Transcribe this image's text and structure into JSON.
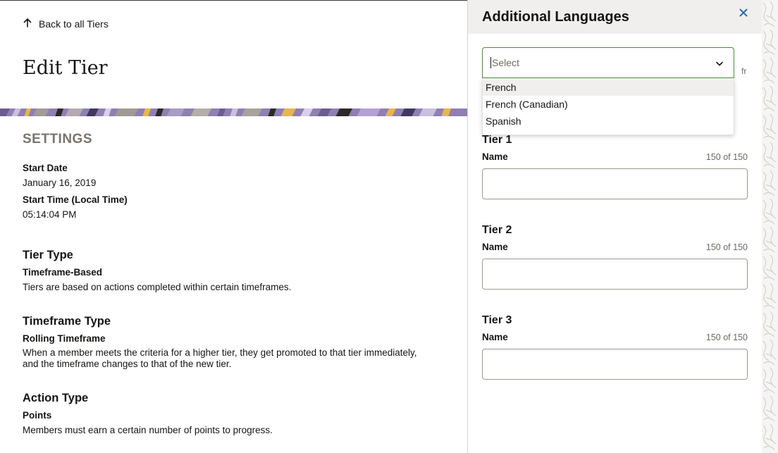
{
  "left": {
    "back_link": "Back to all Tiers",
    "page_title": "Edit Tier",
    "settings_heading": "SETTINGS",
    "start_date_label": "Start Date",
    "start_date_value": "January 16, 2019",
    "start_time_label": "Start Time (Local Time)",
    "start_time_value": "05:14:04 PM",
    "tier_type": {
      "heading": "Tier Type",
      "value": "Timeframe-Based",
      "description": "Tiers are based on actions completed within certain timeframes."
    },
    "timeframe_type": {
      "heading": "Timeframe Type",
      "value": "Rolling Timeframe",
      "description_line1": "When a member meets the criteria for a higher tier, they get promoted to that tier immediately,",
      "description_line2": "and the timeframe changes to that of the new tier."
    },
    "action_type": {
      "heading": "Action Type",
      "value": "Points",
      "description": "Members must earn a certain number of points to progress."
    }
  },
  "panel": {
    "title": "Additional Languages",
    "select_placeholder": "Select",
    "lang_code": "fr",
    "options": [
      "French",
      "French (Canadian)",
      "Spanish"
    ],
    "tiers": [
      {
        "title": "Tier 1",
        "field_label": "Name",
        "counter": "150 of 150",
        "value": ""
      },
      {
        "title": "Tier 2",
        "field_label": "Name",
        "counter": "150 of 150",
        "value": ""
      },
      {
        "title": "Tier 3",
        "field_label": "Name",
        "counter": "150 of 150",
        "value": ""
      }
    ]
  },
  "icons": {
    "back": "arrow-up-icon",
    "close": "close-icon",
    "dropdown": "chevron-down-icon"
  },
  "colors": {
    "accent_green": "#4d8a3f",
    "close_blue": "#2a6ab0",
    "muted_heading": "#7a736e",
    "panel_header_bg": "#f1efed"
  }
}
